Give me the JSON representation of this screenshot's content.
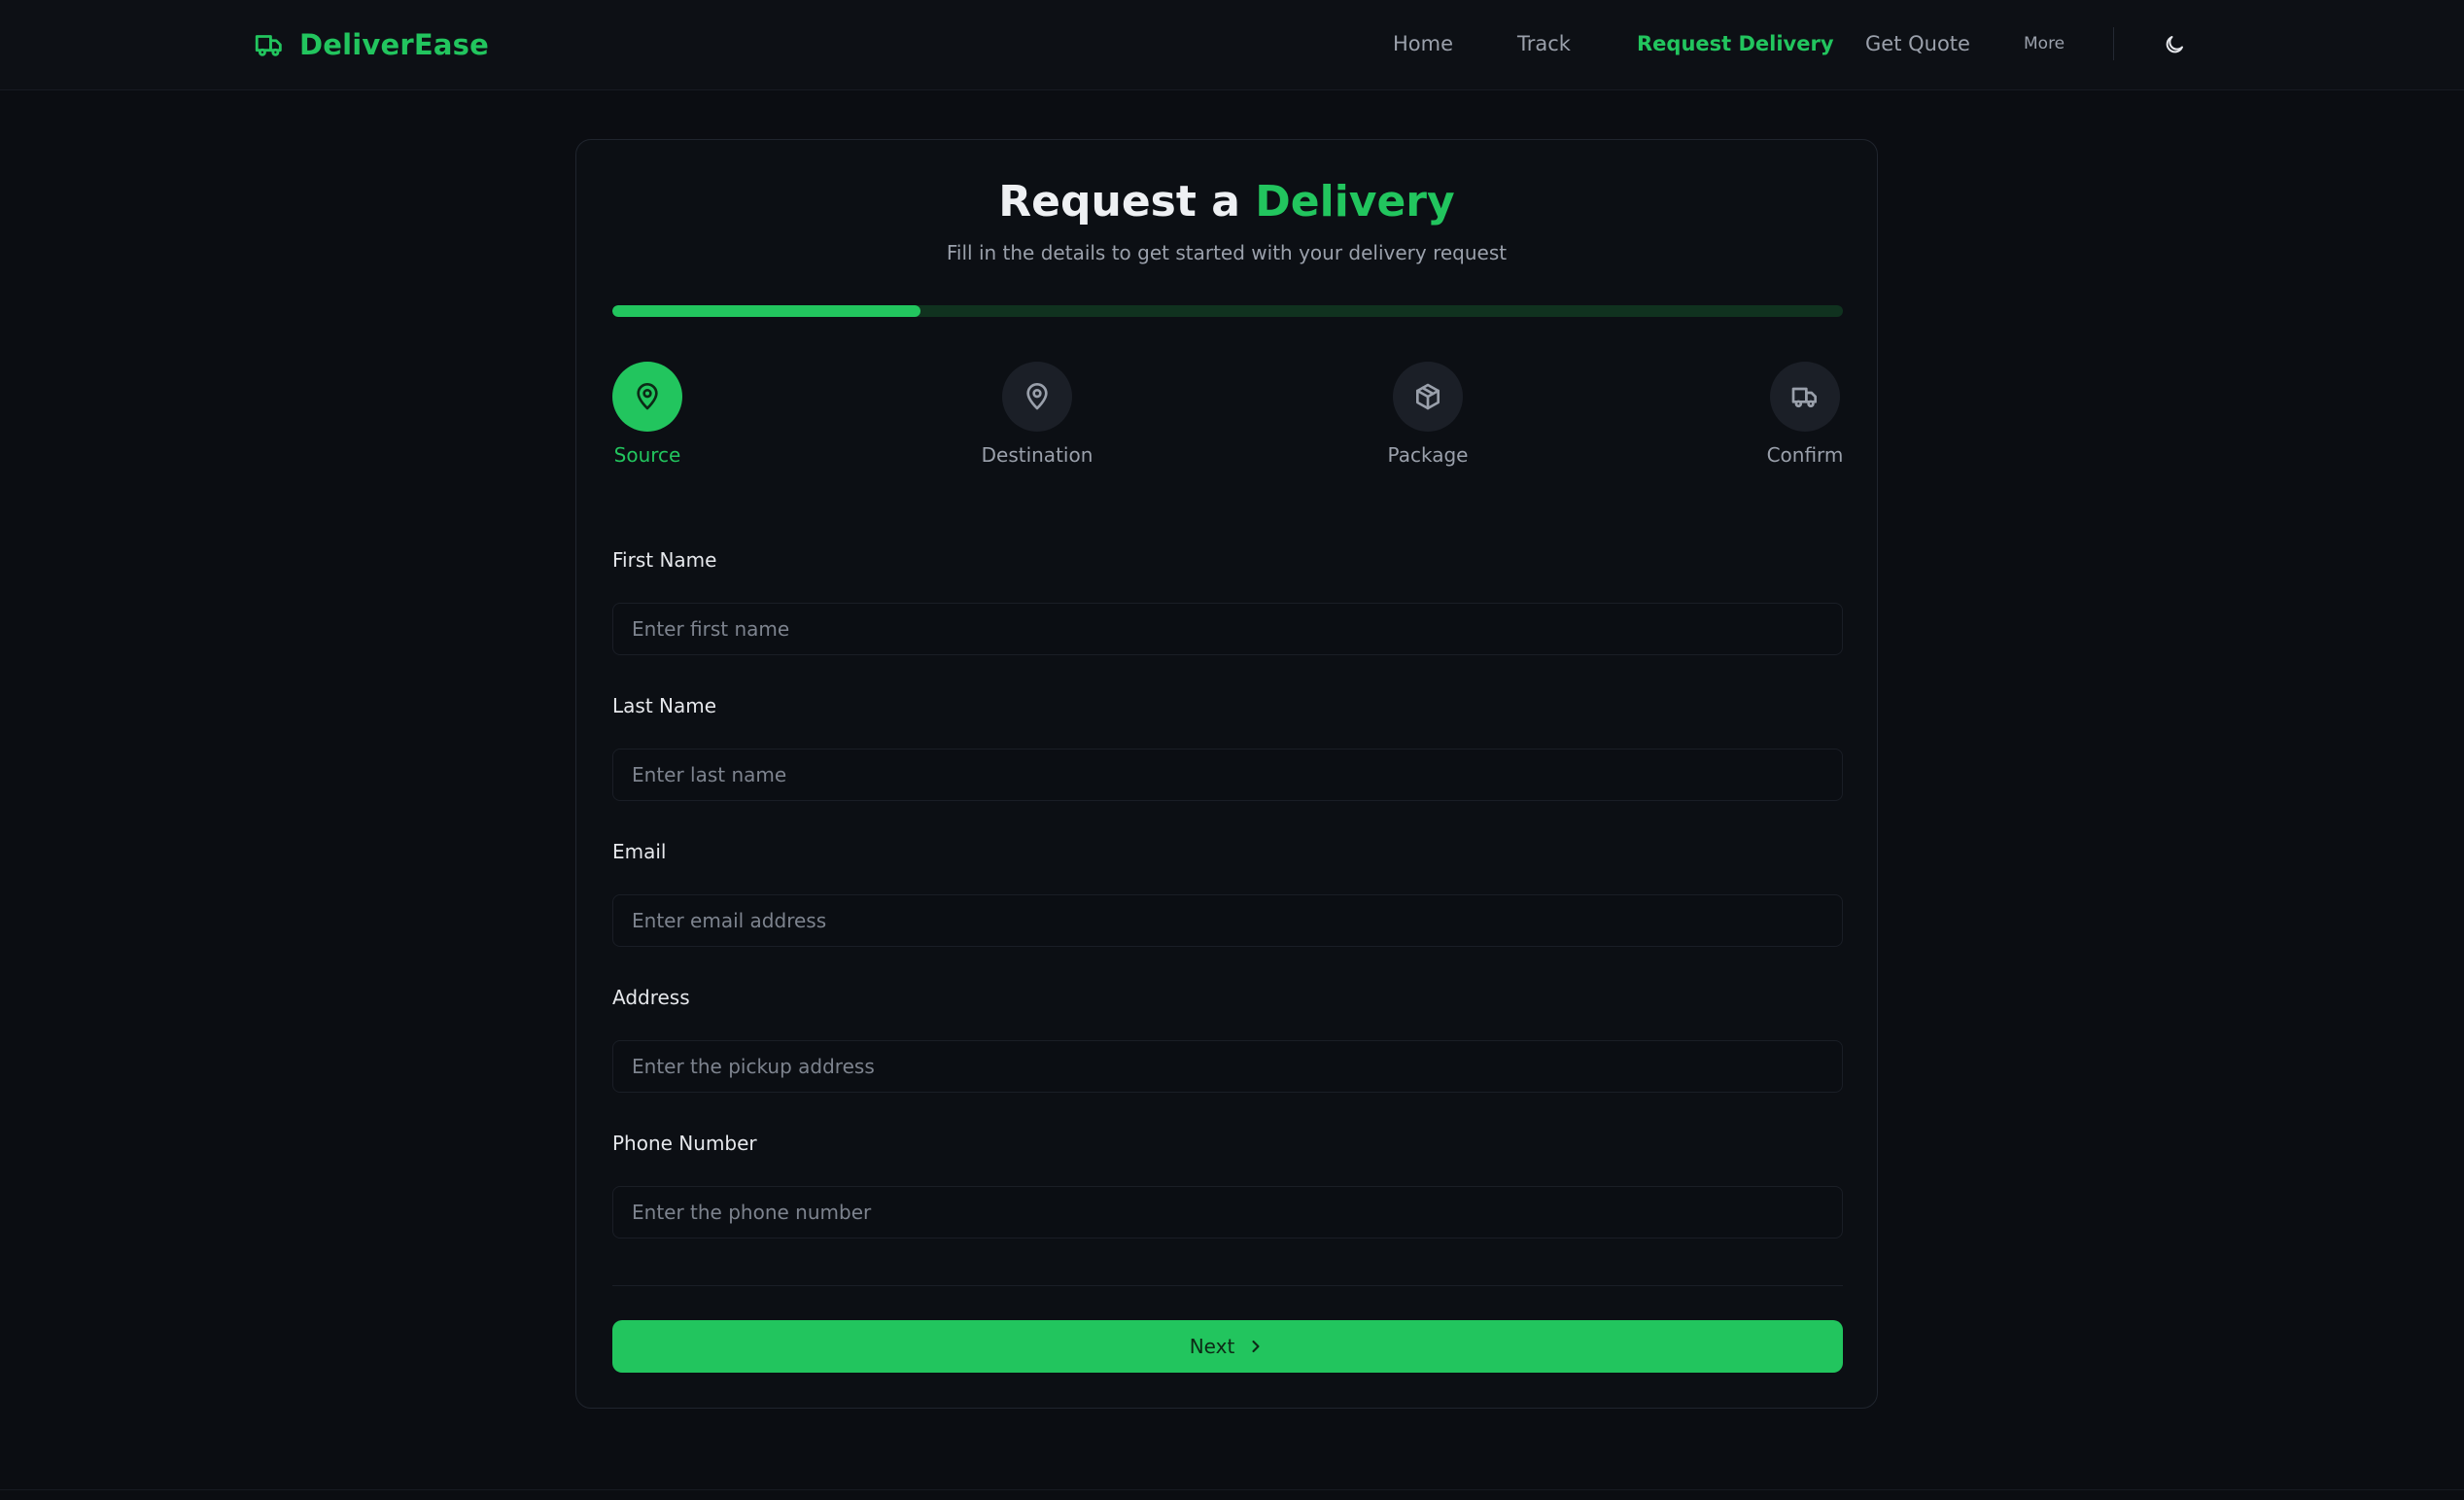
{
  "brand": {
    "name": "DeliverEase",
    "icon": "truck-icon",
    "color": "#22c55e"
  },
  "nav": {
    "items": [
      {
        "label": "Home",
        "active": false
      },
      {
        "label": "Track",
        "active": false
      },
      {
        "label": "Request Delivery",
        "active": true
      },
      {
        "label": "Get Quote",
        "active": false
      },
      {
        "label": "More",
        "active": false
      }
    ],
    "theme_toggle_icon": "moon-icon"
  },
  "card": {
    "title_prefix": "Request a",
    "title_accent": "Delivery",
    "subtitle": "Fill in the details to get started with your delivery request",
    "progress_fraction": 0.25
  },
  "steps": [
    {
      "label": "Source",
      "icon": "map-pin-icon",
      "active": true
    },
    {
      "label": "Destination",
      "icon": "map-pin-icon",
      "active": false
    },
    {
      "label": "Package",
      "icon": "package-icon",
      "active": false
    },
    {
      "label": "Confirm",
      "icon": "truck-icon",
      "active": false
    }
  ],
  "form": {
    "fields": [
      {
        "label": "First Name",
        "placeholder": "Enter first name",
        "value": ""
      },
      {
        "label": "Last Name",
        "placeholder": "Enter last name",
        "value": ""
      },
      {
        "label": "Email",
        "placeholder": "Enter email address",
        "value": ""
      },
      {
        "label": "Address",
        "placeholder": "Enter the pickup address",
        "value": ""
      },
      {
        "label": "Phone Number",
        "placeholder": "Enter the phone number",
        "value": ""
      }
    ],
    "next_label": "Next",
    "next_icon": "chevron-right-icon"
  },
  "colors": {
    "accent": "#22c55e",
    "background": "#0b0d12",
    "card": "#0c0f14",
    "progress_track": "#10321f"
  }
}
